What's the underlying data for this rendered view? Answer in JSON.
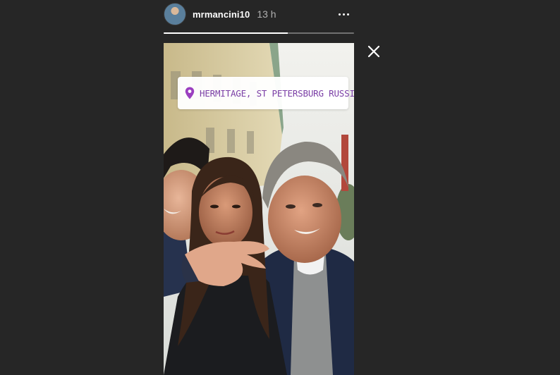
{
  "story": {
    "username": "mrmancini10",
    "time_ago": "13 h",
    "progress": 0.65,
    "location": "HERMITAGE, ST PETERSBURG RUSSIA"
  },
  "icons": {
    "more": "more-horizontal-icon",
    "close": "close-icon",
    "pin": "location-pin-icon"
  },
  "colors": {
    "background": "#262626",
    "sticker_text": "#7b3fa6",
    "pin": "#9b3fc0"
  }
}
